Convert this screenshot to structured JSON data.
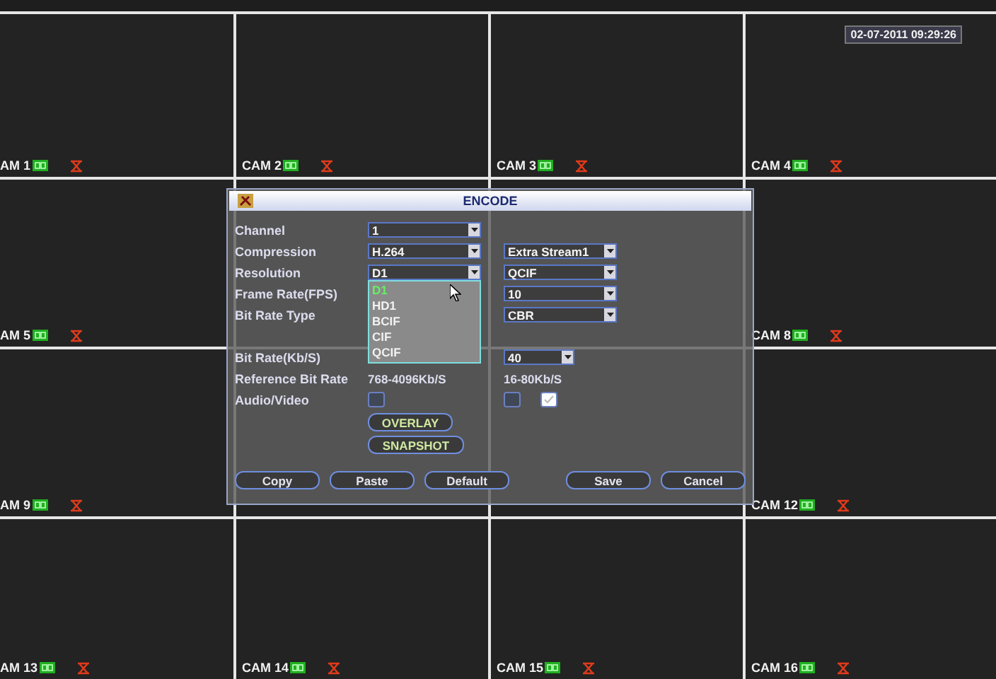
{
  "timestamp": "02-07-2011 09:29:26",
  "tiles": [
    {
      "kind": "camera",
      "label": "AM 1"
    },
    {
      "kind": "camera",
      "label": "CAM 2"
    },
    {
      "kind": "camera",
      "label": "CAM 3"
    },
    {
      "kind": "camera",
      "label": "CAM 4"
    },
    {
      "kind": "camera",
      "label": "AM 5"
    },
    {
      "kind": "covered"
    },
    {
      "kind": "covered"
    },
    {
      "kind": "camera",
      "label": "CAM 8"
    },
    {
      "kind": "camera",
      "label": "AM 9"
    },
    {
      "kind": "covered"
    },
    {
      "kind": "covered"
    },
    {
      "kind": "camera",
      "label": "CAM 12"
    },
    {
      "kind": "camera",
      "label": "AM 13"
    },
    {
      "kind": "camera",
      "label": "CAM 14"
    },
    {
      "kind": "camera",
      "label": "CAM 15"
    },
    {
      "kind": "camera",
      "label": "CAM 16"
    }
  ],
  "dialog": {
    "title": "ENCODE",
    "rows": [
      {
        "label": "Channel",
        "main": [
          {
            "kind": "select",
            "value": "1"
          }
        ],
        "extra": []
      },
      {
        "label": "Compression",
        "main": [
          {
            "kind": "select",
            "value": "H.264"
          }
        ],
        "extra": [
          {
            "kind": "select",
            "value": "Extra Stream1"
          }
        ]
      },
      {
        "label": "Resolution",
        "main": [
          {
            "kind": "select",
            "value": "D1",
            "expanded": true,
            "options": [
              {
                "label": "D1",
                "selected": true
              },
              {
                "label": "HD1",
                "selected": false
              },
              {
                "label": "BCIF",
                "selected": false
              },
              {
                "label": "CIF",
                "selected": false
              },
              {
                "label": "QCIF",
                "selected": false
              }
            ]
          }
        ],
        "extra": [
          {
            "kind": "select",
            "value": "QCIF"
          }
        ]
      },
      {
        "label": "Frame Rate(FPS)",
        "main": [],
        "extra": [
          {
            "kind": "select",
            "value": "10"
          }
        ]
      },
      {
        "label": "Bit Rate Type",
        "main": [],
        "extra": [
          {
            "kind": "select",
            "value": "CBR"
          }
        ]
      },
      {
        "label": "Bit Rate(Kb/S)",
        "main": [],
        "extra": [
          {
            "kind": "short",
            "value": "40"
          }
        ]
      },
      {
        "label": "Reference Bit Rate",
        "main": [
          {
            "kind": "text",
            "value": "768-4096Kb/S"
          }
        ],
        "extra": [
          {
            "kind": "text",
            "value": "16-80Kb/S"
          }
        ]
      },
      {
        "label": "Audio/Video",
        "main": [
          {
            "kind": "checkbox",
            "checked": false
          }
        ],
        "extra": [
          {
            "kind": "checkbox",
            "checked": false
          },
          {
            "kind": "checkbox",
            "checked": true
          }
        ]
      }
    ],
    "actions": [
      "OVERLAY",
      "SNAPSHOT"
    ],
    "footer_left": [
      "Copy",
      "Paste",
      "Default"
    ],
    "footer_right": [
      "Save",
      "Cancel"
    ]
  }
}
